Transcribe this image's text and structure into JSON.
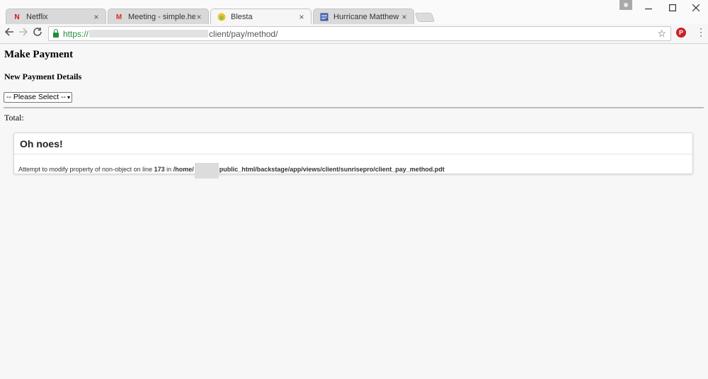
{
  "browser": {
    "tabs": [
      {
        "title": "Netflix",
        "icon": "netflix-icon",
        "favicon_glyph": "N",
        "active": false
      },
      {
        "title": "Meeting - simple.healthy",
        "icon": "gmail-icon",
        "favicon_glyph": "M",
        "active": false
      },
      {
        "title": "Blesta",
        "icon": "blesta-icon",
        "favicon_glyph": "",
        "active": true
      },
      {
        "title": "Hurricane Matthew May",
        "icon": "document-icon",
        "favicon_glyph": "",
        "active": false
      }
    ],
    "close_glyph": "×",
    "url": {
      "scheme": "https://",
      "path": "client/pay/method/"
    }
  },
  "page": {
    "title": "Make Payment",
    "subtitle": "New Payment Details",
    "select": {
      "value": "-- Please Select --",
      "arrow": "▾"
    },
    "total_label": "Total:"
  },
  "error": {
    "title": "Oh noes!",
    "message_before": "Attempt to modify property of non-object on line",
    "line": "173",
    "in_text": "in",
    "path_start": "/home/",
    "path_end": "public_html/backstage/app/views/client/sunrisepro/client_pay_method.pdt"
  },
  "colors": {
    "secure": "#1e8e3e",
    "netflix": "#e50914",
    "gmail": "#d93025",
    "pinterest": "#cb2027"
  }
}
